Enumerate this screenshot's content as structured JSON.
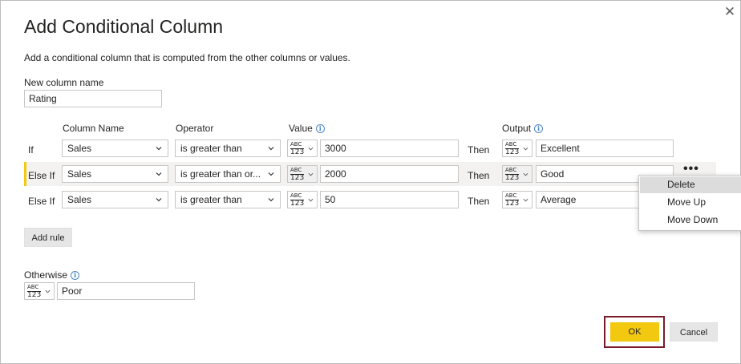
{
  "dialog": {
    "title": "Add Conditional Column",
    "subtitle": "Add a conditional column that is computed from the other columns or values.",
    "close_glyph": "✕"
  },
  "new_column": {
    "label": "New column name",
    "value": "Rating"
  },
  "headers": {
    "column_name": "Column Name",
    "operator": "Operator",
    "value": "Value",
    "output": "Output"
  },
  "type_icon": {
    "top": "ABC",
    "bottom": "123"
  },
  "rules": [
    {
      "keyword": "If",
      "column": "Sales",
      "operator": "is greater than",
      "value": "3000",
      "then": "Then",
      "output": "Excellent"
    },
    {
      "keyword": "Else If",
      "column": "Sales",
      "operator": "is greater than or...",
      "value": "2000",
      "then": "Then",
      "output": "Good"
    },
    {
      "keyword": "Else If",
      "column": "Sales",
      "operator": "is greater than",
      "value": "50",
      "then": "Then",
      "output": "Average"
    }
  ],
  "add_rule_label": "Add rule",
  "otherwise": {
    "label": "Otherwise",
    "value": "Poor"
  },
  "context_menu": {
    "items": [
      "Delete",
      "Move Up",
      "Move Down"
    ],
    "hovered": "Delete"
  },
  "row_menu_glyph": "•••",
  "buttons": {
    "ok": "OK",
    "cancel": "Cancel"
  },
  "colors": {
    "accent_yellow": "#f2c811",
    "highlight_frame": "#7a1b2a",
    "info_blue": "#4a86c5"
  },
  "icons": {
    "close": "close-icon",
    "info": "info-icon",
    "chevron": "chevron-down-icon",
    "more": "more-options-icon"
  }
}
